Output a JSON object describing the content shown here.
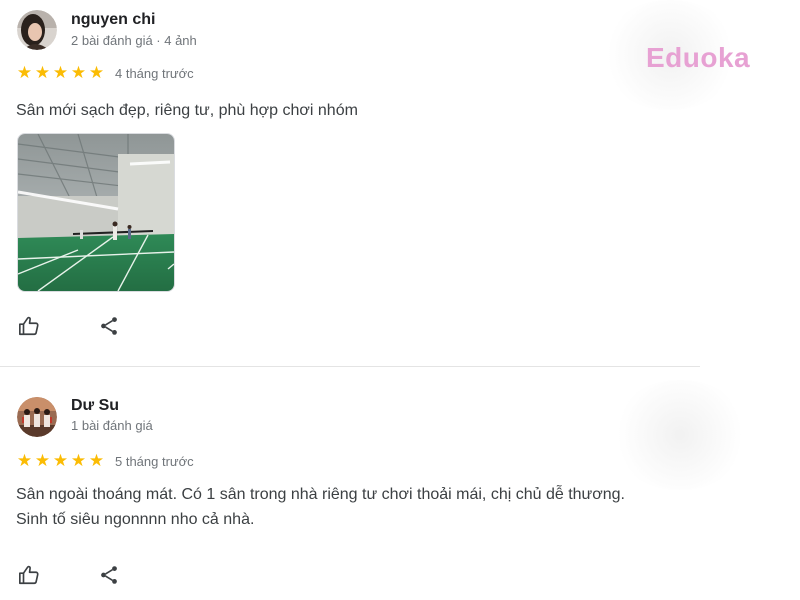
{
  "watermark": {
    "text": "Eduoka",
    "color": "#e7a1d3"
  },
  "reviews": [
    {
      "author": "nguyen chi",
      "meta": "2 bài đánh giá · 4 ảnh",
      "rating": 5,
      "stars": [
        "★",
        "★",
        "★",
        "★",
        "★"
      ],
      "time_ago": "4 tháng trước",
      "text": "Sân mới sạch đẹp, riêng tư, phù hợp chơi nhóm",
      "has_photo": true,
      "photo_icon": "badminton-court-photo",
      "like_icon": "thumbs-up-icon",
      "share_icon": "share-icon"
    },
    {
      "author": "Dư Su",
      "meta": "1 bài đánh giá",
      "rating": 5,
      "stars": [
        "★",
        "★",
        "★",
        "★",
        "★"
      ],
      "time_ago": "5 tháng trước",
      "text": "Sân ngoài thoáng mát. Có 1 sân trong nhà riêng tư chơi thoải mái, chị chủ dễ thương. Sinh tố siêu ngonnnn nho cả nhà.",
      "has_photo": false,
      "like_icon": "thumbs-up-icon",
      "share_icon": "share-icon"
    }
  ],
  "colors": {
    "star": "#fbbc04",
    "name": "#202124",
    "meta": "#70757a",
    "body_text": "#3c4043",
    "divider": "#e4e4e4"
  }
}
